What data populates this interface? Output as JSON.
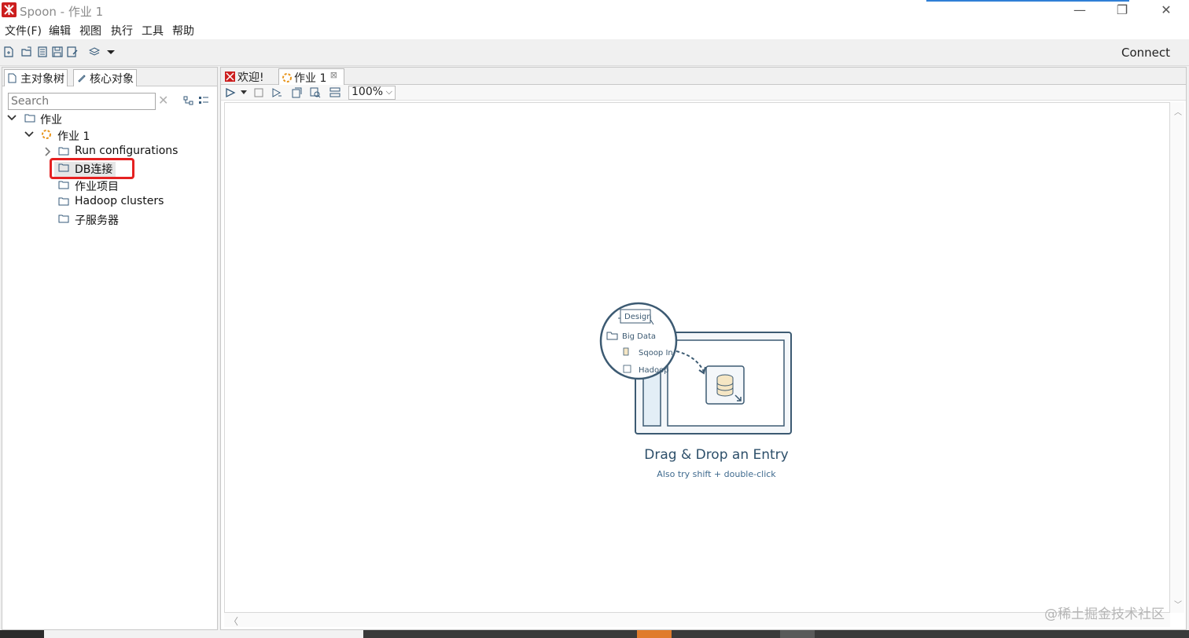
{
  "window": {
    "title": "Spoon - 作业 1",
    "minimize_icon": "—",
    "restore_icon": "❐",
    "close_icon": "✕"
  },
  "menu": [
    "文件(F)",
    "编辑",
    "视图",
    "执行",
    "工具",
    "帮助"
  ],
  "toolbar": {
    "connect_label": "Connect",
    "icons": [
      "new-file-icon",
      "open-file-icon",
      "explore-icon",
      "save-icon",
      "save-as-icon",
      "layers-icon",
      "dropdown-arrow-icon"
    ]
  },
  "left_panel": {
    "tabs": [
      "主对象树",
      "核心对象"
    ],
    "search_placeholder": "Search",
    "search_clear": "✕",
    "tree": [
      {
        "label": "作业",
        "expanded": true
      },
      {
        "label": "作业 1",
        "expanded": true
      },
      {
        "label": "Run configurations",
        "expanded": false
      },
      {
        "label": "DB连接"
      },
      {
        "label": "作业项目"
      },
      {
        "label": "Hadoop clusters"
      },
      {
        "label": "子服务器"
      }
    ]
  },
  "right_panel": {
    "tabs": [
      {
        "label": "欢迎!"
      },
      {
        "label": "作业 1",
        "close": "⊠"
      }
    ],
    "zoom": "100%",
    "zoom_dropdown": "⌵",
    "scroll_up": "︿",
    "scroll_down": "﹀",
    "scroll_left": "〈",
    "illustration": {
      "tab": "Design",
      "folder": "Big Data",
      "item1": "Sqoop In",
      "item2": "Hadoop"
    },
    "drag_drop_title": "Drag & Drop an Entry",
    "drag_drop_sub": "Also try shift + double-click"
  },
  "watermark": "@稀土掘金技术社区",
  "colors": {
    "accent_red": "#e52121",
    "app_icon": "#cc1f1f",
    "illustration_navy": "#2d4f6a"
  }
}
